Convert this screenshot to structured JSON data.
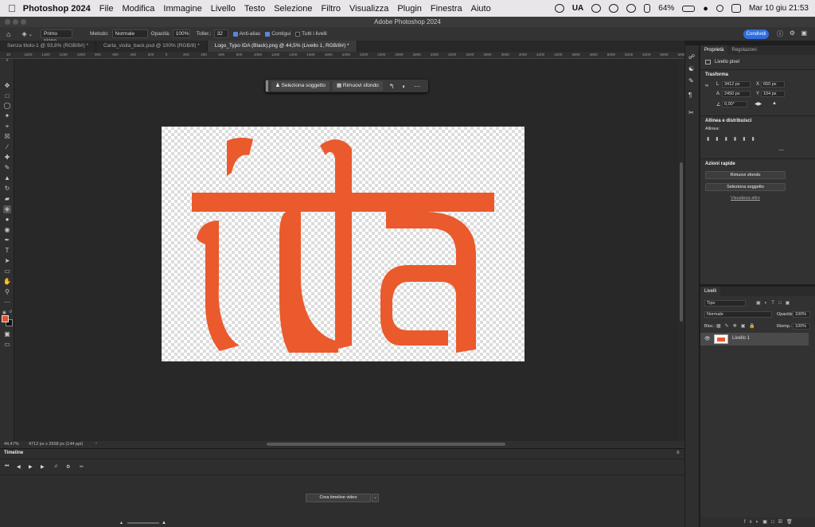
{
  "menubar": {
    "app_name": "Photoshop 2024",
    "items": [
      "File",
      "Modifica",
      "Immagine",
      "Livello",
      "Testo",
      "Selezione",
      "Filtro",
      "Visualizza",
      "Plugin",
      "Finestra",
      "Aiuto"
    ],
    "input_source": "UA",
    "battery": "64%",
    "datetime": "Mar 10 giu  21:53"
  },
  "window": {
    "title": "Adobe Photoshop 2024"
  },
  "options_bar": {
    "mode_select": "Primo piano",
    "method_label": "Metodo:",
    "method_value": "Normale",
    "opacity_label": "Opacità:",
    "opacity_value": "100%",
    "tolerance_label": "Toller.:",
    "tolerance_value": "32",
    "antialias_label": "Anti-alias",
    "contiguous_label": "Contigui",
    "all_layers_label": "Tutti i livelli",
    "share_button": "Condividi"
  },
  "tabs": [
    {
      "label": "Senza titolo-1 @ 93,8% (RGB/8#) *"
    },
    {
      "label": "Carta_visita_back.psd @ 100% (RGB/8) *"
    },
    {
      "label": "Logo_Typo IDA (Black).png @ 44,5% (Livello 1, RGB/8#) *"
    }
  ],
  "ruler_ticks": [
    "20",
    "1600",
    "1400",
    "1200",
    "1000",
    "800",
    "600",
    "400",
    "200",
    "0",
    "200",
    "400",
    "600",
    "800",
    "1000",
    "1200",
    "1400",
    "1600",
    "1800",
    "2000",
    "2200",
    "2400",
    "2600",
    "2800",
    "3000",
    "3200",
    "3400",
    "3600",
    "3800",
    "4000",
    "4200",
    "4400",
    "4600",
    "4800",
    "5000",
    "5200",
    "5400",
    "5600",
    "5800"
  ],
  "context_bar": {
    "select_subject": "Seleziona soggetto",
    "remove_background": "Rimuovi sfondo"
  },
  "status": {
    "zoom": "44,47%",
    "doc_info": "4712 px x 2658 px (144 ppi)"
  },
  "timeline": {
    "title": "Timeline",
    "create_button": "Crea timeline video"
  },
  "properties": {
    "tabs": [
      "Proprietà",
      "Regolazioni"
    ],
    "layer_type": "Livello pixel",
    "transform_title": "Trasforma",
    "w_label": "L",
    "w_value": "3412 px",
    "x_label": "X",
    "x_value": "650 px",
    "h_label": "A",
    "h_value": "2450 px",
    "y_label": "Y",
    "y_value": "104 px",
    "angle_value": "0,00°",
    "align_title": "Allinea e distribuisci",
    "align_label": "Allinea:",
    "quick_title": "Azioni rapide",
    "quick_remove": "Rimuovi sfondo",
    "quick_select": "Seleziona soggetto",
    "see_more": "Visualizza altro"
  },
  "layers": {
    "title": "Livelli",
    "filter_label": "Tipo",
    "blend_mode": "Normale",
    "opacity_label": "Opacità:",
    "opacity_value": "100%",
    "lock_label": "Bloc.:",
    "fill_label": "Riemp.:",
    "fill_value": "100%",
    "items": [
      {
        "name": "Livello 1"
      }
    ]
  },
  "colors": {
    "logo": "#ea5a2c",
    "foreground": "#e3532a",
    "accent": "#2f6ee0"
  }
}
